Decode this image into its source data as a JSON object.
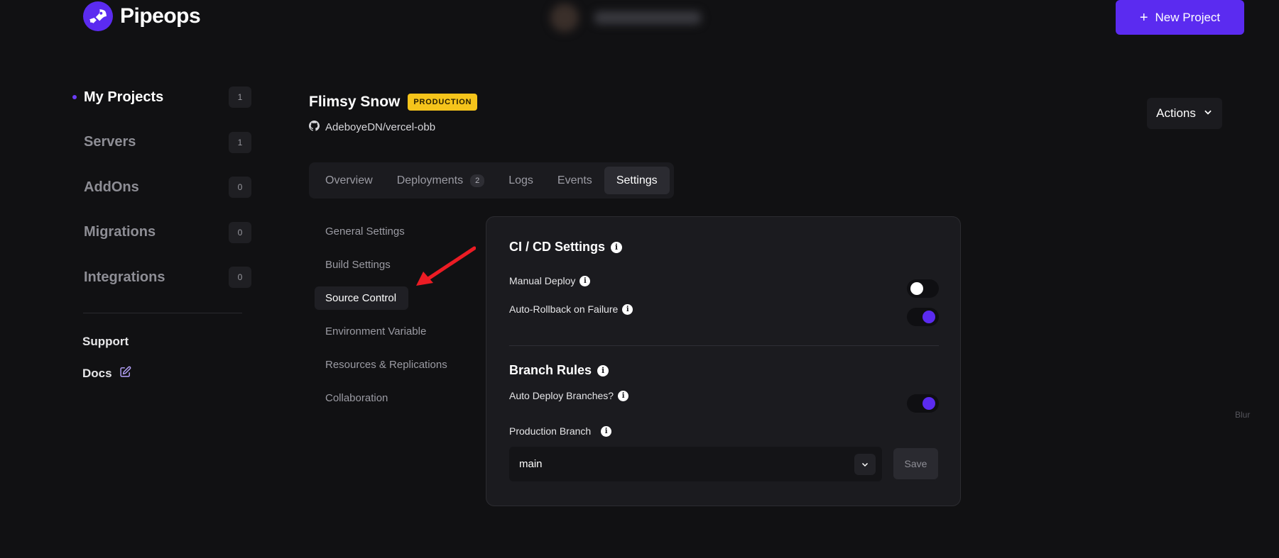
{
  "brand": {
    "name": "Pipeops",
    "accent": "#5b2bf0"
  },
  "header": {
    "new_project_label": "New Project"
  },
  "sidebar": {
    "items": [
      {
        "label": "My Projects",
        "count": "1",
        "active": true
      },
      {
        "label": "Servers",
        "count": "1"
      },
      {
        "label": "AddOns",
        "count": "0"
      },
      {
        "label": "Migrations",
        "count": "0"
      },
      {
        "label": "Integrations",
        "count": "0"
      }
    ],
    "support_label": "Support",
    "docs_label": "Docs"
  },
  "project": {
    "name": "Flimsy Snow",
    "environment_badge": "PRODUCTION",
    "badge_color": "#f5c41b",
    "repo": "AdeboyeDN/vercel-obb",
    "actions_label": "Actions"
  },
  "tabs": [
    {
      "label": "Overview"
    },
    {
      "label": "Deployments",
      "count": "2"
    },
    {
      "label": "Logs"
    },
    {
      "label": "Events"
    },
    {
      "label": "Settings",
      "active": true
    }
  ],
  "settings_nav": [
    {
      "label": "General Settings"
    },
    {
      "label": "Build Settings"
    },
    {
      "label": "Source Control",
      "active": true
    },
    {
      "label": "Environment Variable"
    },
    {
      "label": "Resources & Replications"
    },
    {
      "label": "Collaboration"
    }
  ],
  "panel": {
    "cicd_title": "CI / CD Settings",
    "manual_deploy_label": "Manual Deploy",
    "manual_deploy_enabled": false,
    "auto_rollback_label": "Auto-Rollback on Failure",
    "auto_rollback_enabled": true,
    "branch_rules_title": "Branch Rules",
    "auto_deploy_label": "Auto Deploy Branches?",
    "auto_deploy_enabled": true,
    "production_branch_label": "Production Branch",
    "production_branch_value": "main",
    "save_label": "Save"
  },
  "blur_label": "Blur"
}
